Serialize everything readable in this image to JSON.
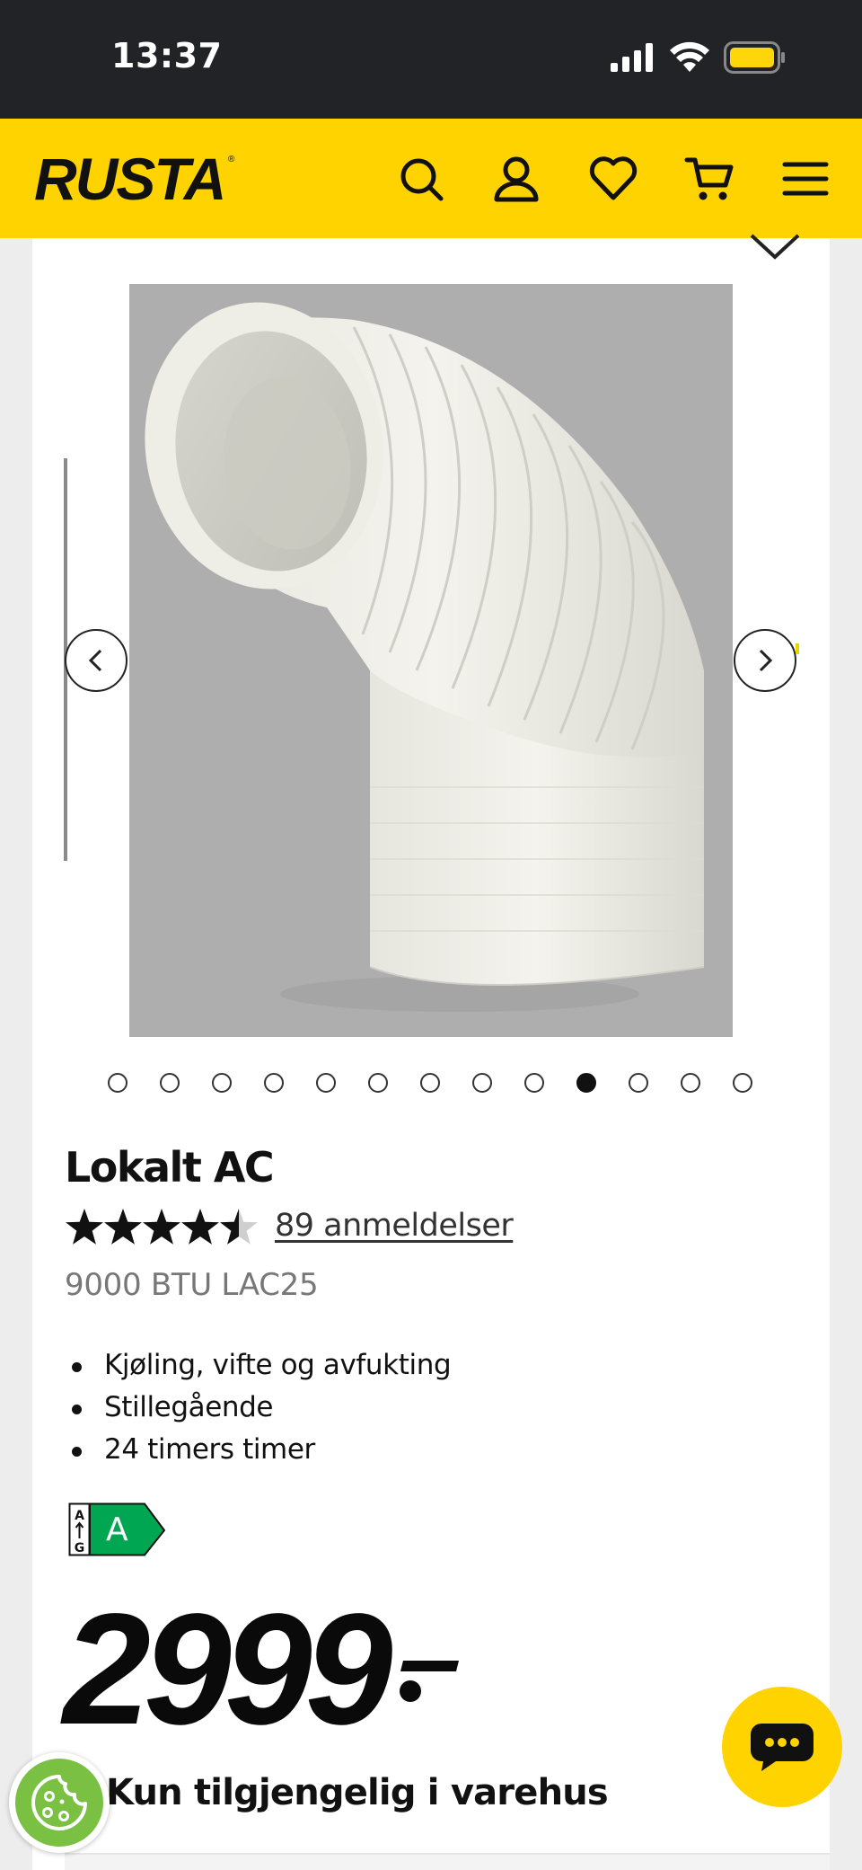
{
  "status_bar": {
    "time": "13:37"
  },
  "header": {
    "logo_text": "RUSTA",
    "icons": [
      "search-icon",
      "account-icon",
      "heart-icon",
      "cart-icon",
      "menu-icon"
    ],
    "background_color": "#ffd300"
  },
  "gallery": {
    "image_alt": "Flexible white exhaust hose elbow",
    "image_count": 13,
    "active_index": 9,
    "prev_icon": "chevron-left-icon",
    "next_icon": "chevron-right-icon"
  },
  "product": {
    "title": "Lokalt AC",
    "rating": 4.5,
    "rating_max": 5,
    "reviews_text": "89 anmeldelser",
    "subtitle": "9000 BTU LAC25",
    "features": [
      "Kjøling, vifte og avfukting",
      "Stillegående",
      "24 timers timer"
    ],
    "energy_label": {
      "scale_top": "A",
      "scale_bottom": "G",
      "class": "A",
      "color": "#00a651"
    },
    "price": "2999",
    "availability": "Kun tilgjengelig i varehus"
  },
  "floating": {
    "cookie_icon": "cookie-icon",
    "chat_icon": "chat-icon"
  }
}
